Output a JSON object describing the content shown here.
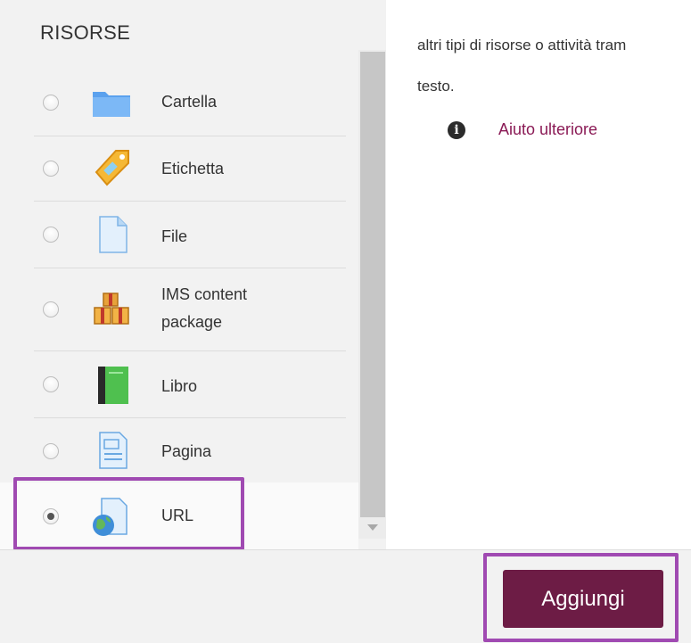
{
  "resources": {
    "heading": "RISORSE",
    "items": [
      {
        "label": "Cartella",
        "icon": "folder-icon",
        "selected": false
      },
      {
        "label": "Etichetta",
        "icon": "label-tag-icon",
        "selected": false
      },
      {
        "label": "File",
        "icon": "file-icon",
        "selected": false
      },
      {
        "label_line1": "IMS content",
        "label_line2": "package",
        "icon": "package-icon",
        "selected": false
      },
      {
        "label": "Libro",
        "icon": "book-icon",
        "selected": false
      },
      {
        "label": "Pagina",
        "icon": "page-icon",
        "selected": false
      },
      {
        "label": "URL",
        "icon": "url-globe-icon",
        "selected": true
      }
    ]
  },
  "description": {
    "line1": "altri tipi di risorse o attività tram",
    "line2": "testo."
  },
  "help": {
    "icon": "info-icon",
    "link_text": "Aiuto ulteriore"
  },
  "footer": {
    "add_label": "Aggiungi"
  },
  "colors": {
    "accent": "#6d1c45",
    "highlight": "#a04ab2",
    "link": "#8a1a55"
  }
}
